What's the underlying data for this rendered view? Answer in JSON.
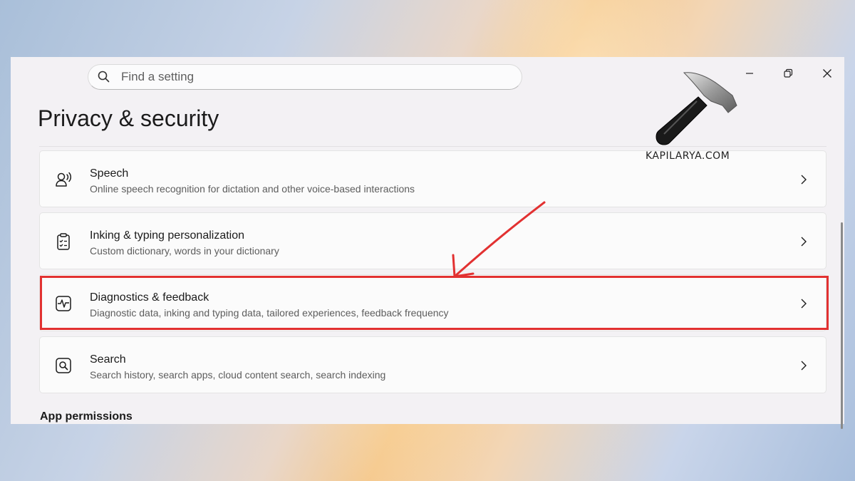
{
  "search": {
    "placeholder": "Find a setting",
    "value": ""
  },
  "page": {
    "title": "Privacy & security"
  },
  "settings": [
    {
      "title": "Speech",
      "description": "Online speech recognition for dictation and other voice-based interactions",
      "icon": "speech-icon"
    },
    {
      "title": "Inking & typing personalization",
      "description": "Custom dictionary, words in your dictionary",
      "icon": "clipboard-checklist-icon"
    },
    {
      "title": "Diagnostics & feedback",
      "description": "Diagnostic data, inking and typing data, tailored experiences, feedback frequency",
      "icon": "pulse-icon"
    },
    {
      "title": "Search",
      "description": "Search history, search apps, cloud content search, search indexing",
      "icon": "search-box-icon"
    }
  ],
  "section": {
    "app_permissions": "App permissions"
  },
  "watermark": {
    "text": "KAPILARYA.COM"
  },
  "colors": {
    "highlight": "#e23131",
    "window_bg": "#f3f1f4",
    "card_bg": "#fbfbfb"
  }
}
